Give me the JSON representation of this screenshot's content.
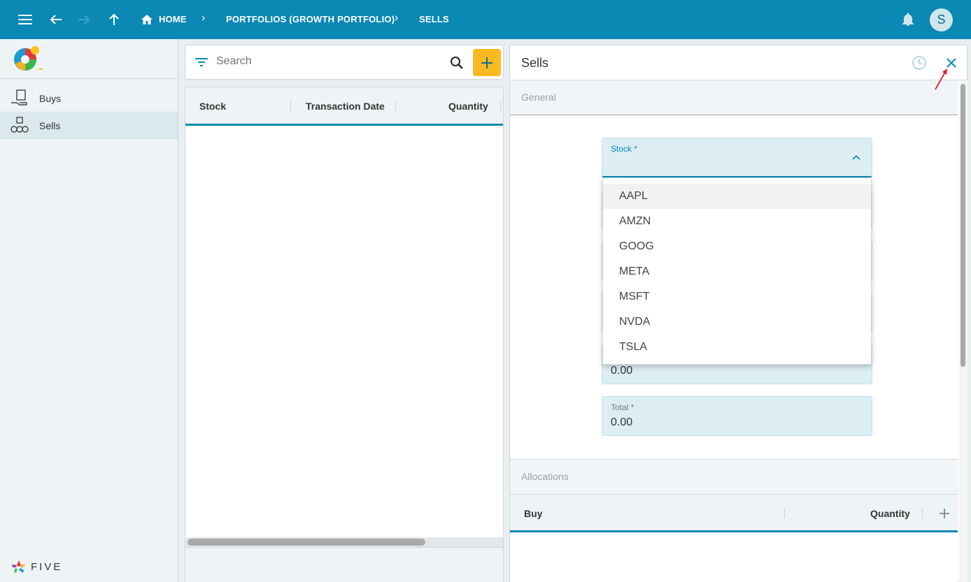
{
  "topbar": {
    "breadcrumbs": [
      "HOME",
      "PORTFOLIOS (GROWTH PORTFOLIO)",
      "SELLS"
    ],
    "avatar_letter": "S",
    "colors": {
      "bar": "#0b88b3",
      "accent": "#f9b920"
    }
  },
  "sidebar": {
    "items": [
      {
        "label": "Buys",
        "icon": "buy-icon",
        "active": false
      },
      {
        "label": "Sells",
        "icon": "sell-icon",
        "active": true
      }
    ],
    "brand": "FIVE"
  },
  "list": {
    "search_placeholder": "Search",
    "columns": [
      "Stock",
      "Transaction Date",
      "Quantity"
    ],
    "rows": []
  },
  "form": {
    "title": "Sells",
    "general_label": "General",
    "fields": [
      {
        "label": "Stock *",
        "value": ""
      },
      {
        "label": "",
        "value": "0.00"
      },
      {
        "label": "Total *",
        "value": "0.00"
      }
    ],
    "allocations_label": "Allocations",
    "allocation_columns": [
      "Buy",
      "Quantity"
    ],
    "stock_options": [
      "AAPL",
      "AMZN",
      "GOOG",
      "META",
      "MSFT",
      "NVDA",
      "TSLA"
    ]
  }
}
